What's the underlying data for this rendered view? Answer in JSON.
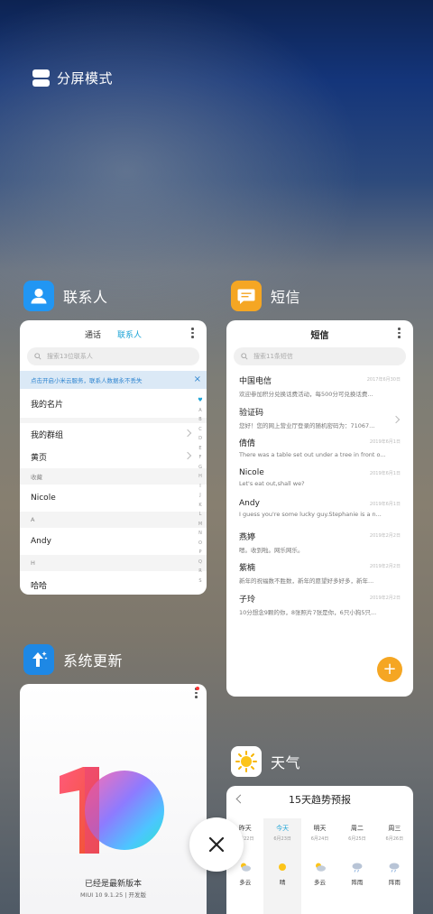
{
  "split": {
    "label": "分屏模式",
    "icon": "split-screen-icon"
  },
  "contacts": {
    "app_name": "联系人",
    "icon_color": "#2196f3",
    "tabs": [
      "通话",
      "联系人"
    ],
    "search_placeholder": "搜索13位联系人",
    "banner": "点击开启小米云服务，联系人数据永不丢失",
    "rows": {
      "my_card": "我的名片",
      "my_groups": "我的群组",
      "yellow_pages": "黄页",
      "favorites_header": "收藏",
      "nicole": "Nicole",
      "section_a": "A",
      "andy": "Andy",
      "section_h": "H",
      "haha": "哈哈"
    },
    "index_letters": [
      "A",
      "B",
      "C",
      "D",
      "E",
      "F",
      "G",
      "H",
      "I",
      "J",
      "K",
      "L",
      "M",
      "N",
      "O",
      "P",
      "Q",
      "R",
      "S"
    ]
  },
  "sms": {
    "app_name": "短信",
    "icon_color": "#f5a623",
    "title": "短信",
    "search_placeholder": "搜索11条短信",
    "messages": [
      {
        "name": "中国电信",
        "preview": "欢迎参加积分兑换话费活动，每500分可兑换话费...",
        "date": "2017年6月30日"
      },
      {
        "name": "验证码",
        "preview": "您好！您的网上营业厅登录的随机密码为：71067...",
        "date": ""
      },
      {
        "name": "倩倩",
        "preview": "There was a table set out under a tree in front o...",
        "date": "2019年6月1日"
      },
      {
        "name": "Nicole",
        "preview": "Let's eat out,shall we?",
        "date": "2019年6月1日"
      },
      {
        "name": "Andy",
        "preview": "I guess you're some lucky guy.Stephanie is a n...",
        "date": "2019年6月1日"
      },
      {
        "name": "燕婷",
        "preview": "嗯。收到啦。网乐网乐。",
        "date": "2019年2月2日"
      },
      {
        "name": "紫楠",
        "preview": "新年的祝福数不胜数，新年的愿望好多好多，新年...",
        "date": "2019年2月2日"
      },
      {
        "name": "子玲",
        "preview": "10分想念9颗的你，8张照片7张是你，6只小狗5只...",
        "date": "2019年2月2日"
      }
    ],
    "fab": "+"
  },
  "update": {
    "app_name": "系统更新",
    "icon_color": "#1e88e5",
    "status": "已经是最新版本",
    "version": "MIUI 10 9.1.25 | 开发版"
  },
  "weather": {
    "app_name": "天气",
    "title": "15天趋势预报",
    "days": [
      {
        "day": "昨天",
        "date": "6月22日",
        "cond": "多云",
        "icon": "partly-cloudy-icon"
      },
      {
        "day": "今天",
        "date": "6月23日",
        "cond": "晴",
        "icon": "sun-icon"
      },
      {
        "day": "明天",
        "date": "6月24日",
        "cond": "多云",
        "icon": "partly-cloudy-icon"
      },
      {
        "day": "周二",
        "date": "6月25日",
        "cond": "阵雨",
        "icon": "rain-icon"
      },
      {
        "day": "周三",
        "date": "6月26日",
        "cond": "阵雨",
        "icon": "rain-icon"
      }
    ]
  },
  "close": {
    "icon": "close-icon"
  }
}
